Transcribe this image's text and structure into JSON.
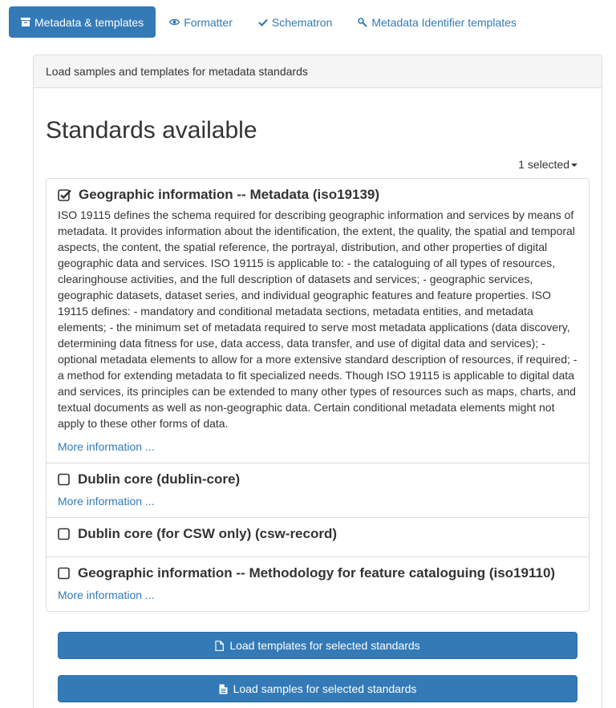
{
  "tabs": [
    {
      "label": "Metadata & templates",
      "icon": "archive-icon",
      "active": true
    },
    {
      "label": "Formatter",
      "icon": "eye-icon",
      "active": false
    },
    {
      "label": "Schematron",
      "icon": "check-icon",
      "active": false
    },
    {
      "label": "Metadata Identifier templates",
      "icon": "wrench-icon",
      "active": false
    }
  ],
  "panel": {
    "heading": "Load samples and templates for metadata standards",
    "title": "Standards available",
    "selected_dropdown": "1 selected"
  },
  "standards": [
    {
      "title": "Geographic information -- Metadata (iso19139)",
      "checked": true,
      "description": "ISO 19115 defines the schema required for describing geographic information and services by means of metadata. It provides information about the identification, the extent, the quality, the spatial and temporal aspects, the content, the spatial reference, the portrayal, distribution, and other properties of digital geographic data and services. ISO 19115 is applicable to: - the cataloguing of all types of resources, clearinghouse activities, and the full description of datasets and services; - geographic services, geographic datasets, dataset series, and individual geographic features and feature properties. ISO 19115 defines: - mandatory and conditional metadata sections, metadata entities, and metadata elements; - the minimum set of metadata required to serve most metadata applications (data discovery, determining data fitness for use, data access, data transfer, and use of digital data and services); - optional metadata elements to allow for a more extensive standard description of resources, if required; - a method for extending metadata to fit specialized needs. Though ISO 19115 is applicable to digital data and services, its principles can be extended to many other types of resources such as maps, charts, and textual documents as well as non-geographic data. Certain conditional metadata elements might not apply to these other forms of data.",
      "more_link": "More information ..."
    },
    {
      "title": "Dublin core (dublin-core)",
      "checked": false,
      "more_link": "More information ..."
    },
    {
      "title": "Dublin core (for CSW only) (csw-record)",
      "checked": false
    },
    {
      "title": "Geographic information -- Methodology for feature cataloguing (iso19110)",
      "checked": false,
      "more_link": "More information ..."
    }
  ],
  "buttons": {
    "load_templates": "Load templates for selected standards",
    "load_samples": "Load samples for selected standards"
  },
  "colors": {
    "primary": "#337ab7",
    "link": "#337ab7",
    "border": "#dddddd",
    "panel_heading_bg": "#f5f5f5"
  }
}
